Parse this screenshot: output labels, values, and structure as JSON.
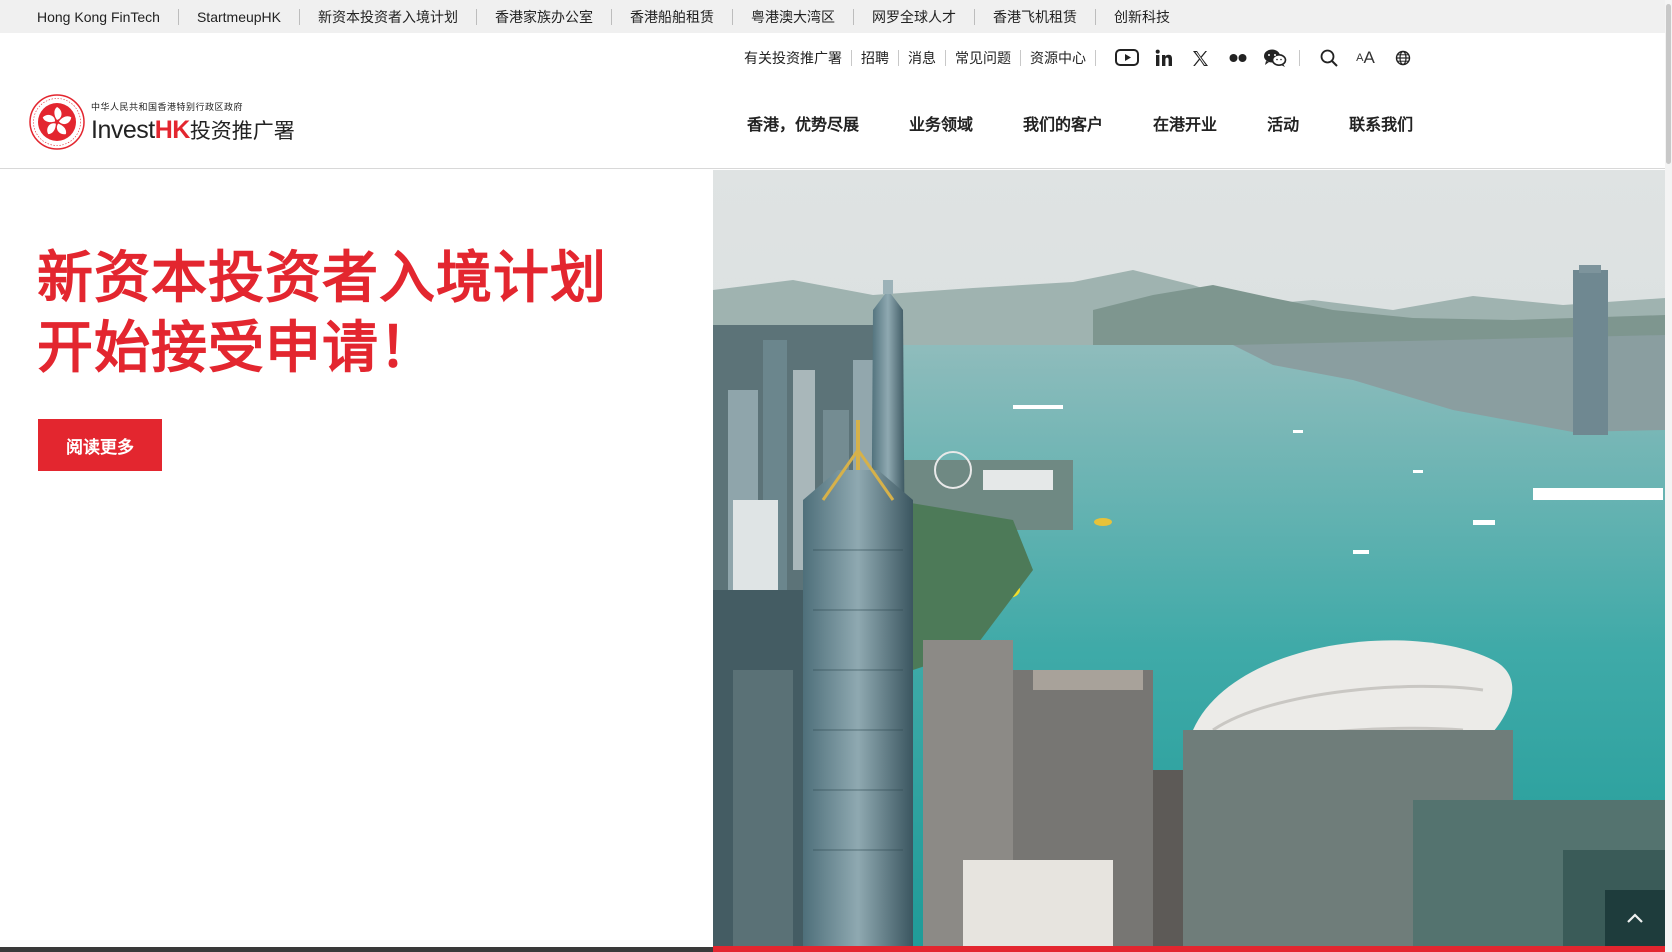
{
  "topbar": {
    "links": [
      "Hong Kong FinTech",
      "StartmeupHK",
      "新资本投资者入境计划",
      "香港家族办公室",
      "香港船舶租赁",
      "粤港澳大湾区",
      "网罗全球人才",
      "香港飞机租赁",
      "创新科技"
    ]
  },
  "header": {
    "utility_links": [
      "有关投资推广署",
      "招聘",
      "消息",
      "常见问题",
      "资源中心"
    ],
    "social_icons": [
      "youtube-icon",
      "linkedin-icon",
      "x-icon",
      "flickr-icon",
      "wechat-icon"
    ],
    "tools": {
      "search_icon": "search-icon",
      "fontsize_small": "A",
      "fontsize_large": "A",
      "language_icon": "globe-icon"
    },
    "logo": {
      "gov_line": "中华人民共和国香港特别行政区政府",
      "brand_invest": "Invest",
      "brand_hk": "HK",
      "brand_cn": "投资推广署"
    },
    "main_nav": [
      "香港，优势尽展",
      "业务领域",
      "我们的客户",
      "在港开业",
      "活动",
      "联系我们"
    ]
  },
  "hero": {
    "title": "新资本投资者入境计划\n开始接受申请！",
    "cta_label": "阅读更多"
  },
  "colors": {
    "brand_red": "#e3262f",
    "topbar_bg": "#f0f0f0"
  },
  "back_to_top_icon": "chevron-up-icon"
}
